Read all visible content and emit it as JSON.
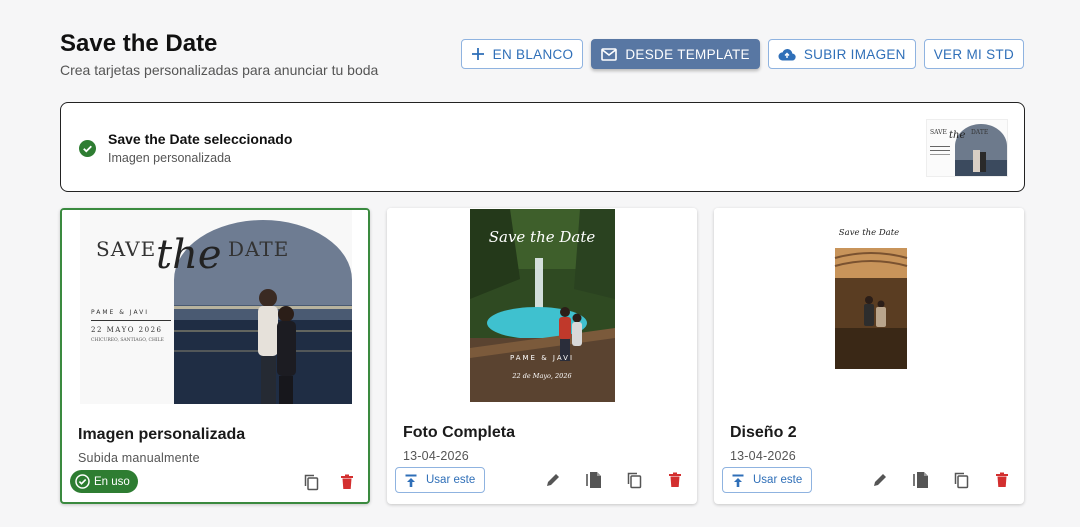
{
  "header": {
    "title": "Save the Date",
    "subtitle": "Crea tarjetas personalizadas para anunciar tu boda"
  },
  "toolbar": {
    "blank_label": "EN BLANCO",
    "template_label": "DESDE TEMPLATE",
    "upload_label": "SUBIR IMAGEN",
    "view_label": "VER MI STD"
  },
  "selected": {
    "title": "Save the Date seleccionado",
    "subtitle": "Imagen personalizada"
  },
  "design_text": {
    "save": "SAVE",
    "the": "the",
    "date": "DATE",
    "names": "PAME & JAVI",
    "date_line": "22 MAYO 2026",
    "place": "CHICUREO, SANTIAGO, CHILE",
    "script_title": "Save the Date",
    "names_photo": "PAME & JAVI",
    "date_photo": "22 de Mayo, 2026"
  },
  "cards": [
    {
      "title": "Imagen personalizada",
      "subtitle": "Subida manualmente",
      "badge": "En uso"
    },
    {
      "title": "Foto Completa",
      "subtitle": "13-04-2026",
      "use_label": "Usar este"
    },
    {
      "title": "Diseño 2",
      "subtitle": "13-04-2026",
      "use_label": "Usar este"
    }
  ],
  "colors": {
    "accent": "#2f6fb8",
    "primary_button": "#5877a3",
    "success": "#2e7d32",
    "danger": "#d32f2f"
  },
  "icons": [
    "plus-icon",
    "mail-icon",
    "cloud-upload-icon",
    "check-circle-icon",
    "copy-icon",
    "delete-icon",
    "upload-icon",
    "edit-icon",
    "file-copy-icon"
  ]
}
